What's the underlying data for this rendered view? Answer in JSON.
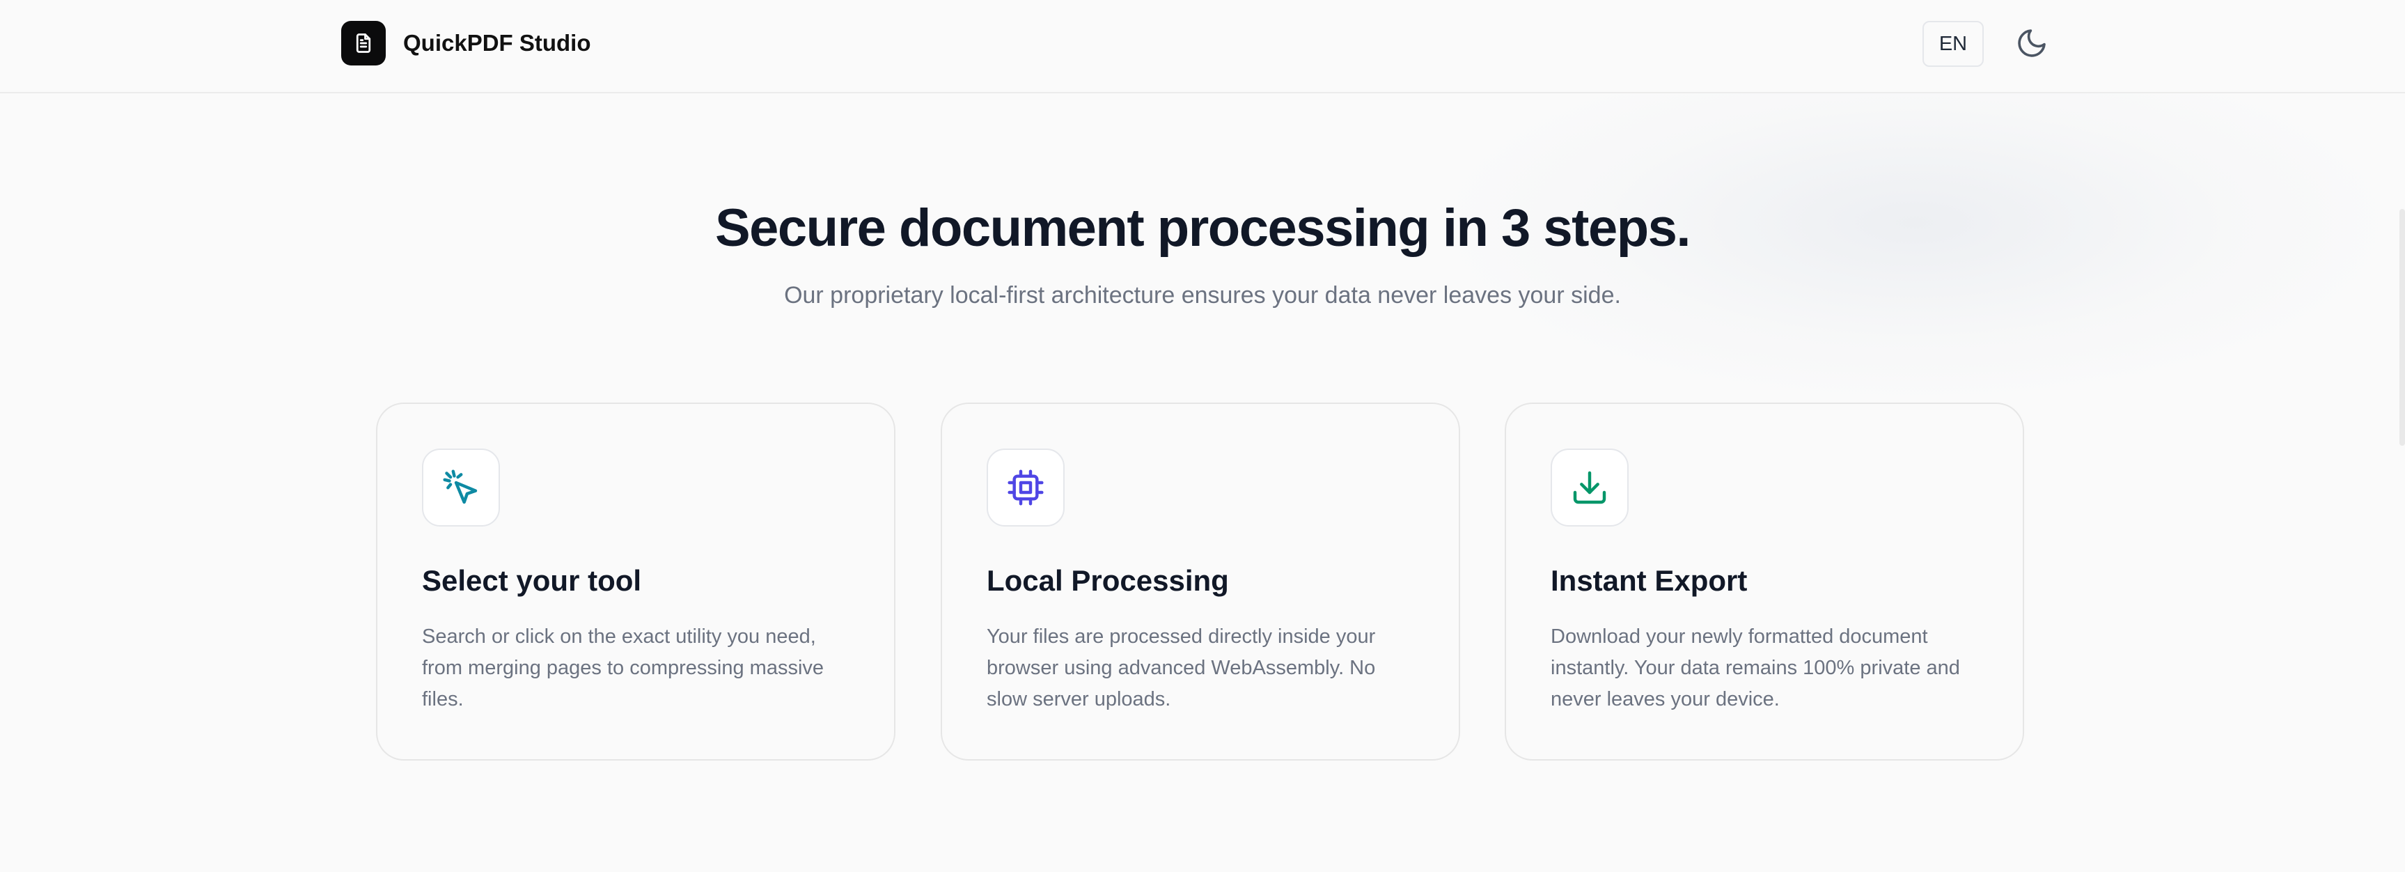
{
  "header": {
    "brand": "QuickPDF Studio",
    "logo_icon": "document-icon",
    "language": "EN",
    "theme_icon": "moon-icon"
  },
  "hero": {
    "title": "Secure document processing in 3 steps.",
    "subtitle": "Our proprietary local-first architecture ensures your data never leaves your side."
  },
  "steps": [
    {
      "icon": "cursor-click-icon",
      "icon_color": "#0e8aa3",
      "title": "Select your tool",
      "description": "Search or click on the exact utility you need, from merging pages to compressing massive files."
    },
    {
      "icon": "cpu-chip-icon",
      "icon_color": "#4f46e5",
      "title": "Local Processing",
      "description": "Your files are processed directly inside your browser using advanced WebAssembly. No slow server uploads."
    },
    {
      "icon": "download-icon",
      "icon_color": "#059669",
      "title": "Instant Export",
      "description": "Download your newly formatted document instantly. Your data remains 100% private and never leaves your device."
    }
  ],
  "colors": {
    "background": "#fafafa",
    "heading": "#111827",
    "muted": "#6b7280",
    "border": "#e6e6e6"
  }
}
